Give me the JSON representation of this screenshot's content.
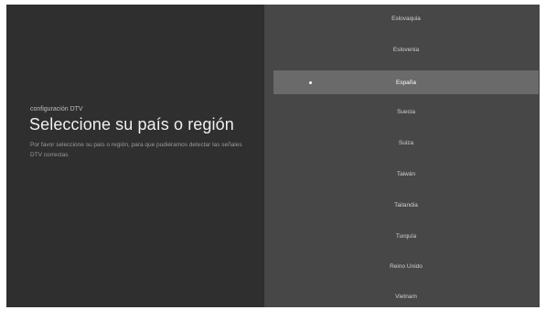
{
  "left_panel": {
    "subtitle": "configuración DTV",
    "title": "Seleccione su país o región",
    "description": "Por favor seleccione su país o región, para que pudiéramos detectar las señales DTV correctas"
  },
  "country_list": {
    "items": [
      {
        "label": "Eslovaquia",
        "selected": false
      },
      {
        "label": "Eslovenia",
        "selected": false
      },
      {
        "label": "España",
        "selected": true
      },
      {
        "label": "Suecia",
        "selected": false
      },
      {
        "label": "Suiza",
        "selected": false
      },
      {
        "label": "Taiwán",
        "selected": false
      },
      {
        "label": "Tailandia",
        "selected": false
      },
      {
        "label": "Turquía",
        "selected": false
      },
      {
        "label": "Reino Unido",
        "selected": false
      },
      {
        "label": "Vietnam",
        "selected": false
      }
    ]
  },
  "colors": {
    "left_background": "#2f2f2f",
    "right_background": "#474747",
    "selected_background": "#6a6a6a"
  }
}
